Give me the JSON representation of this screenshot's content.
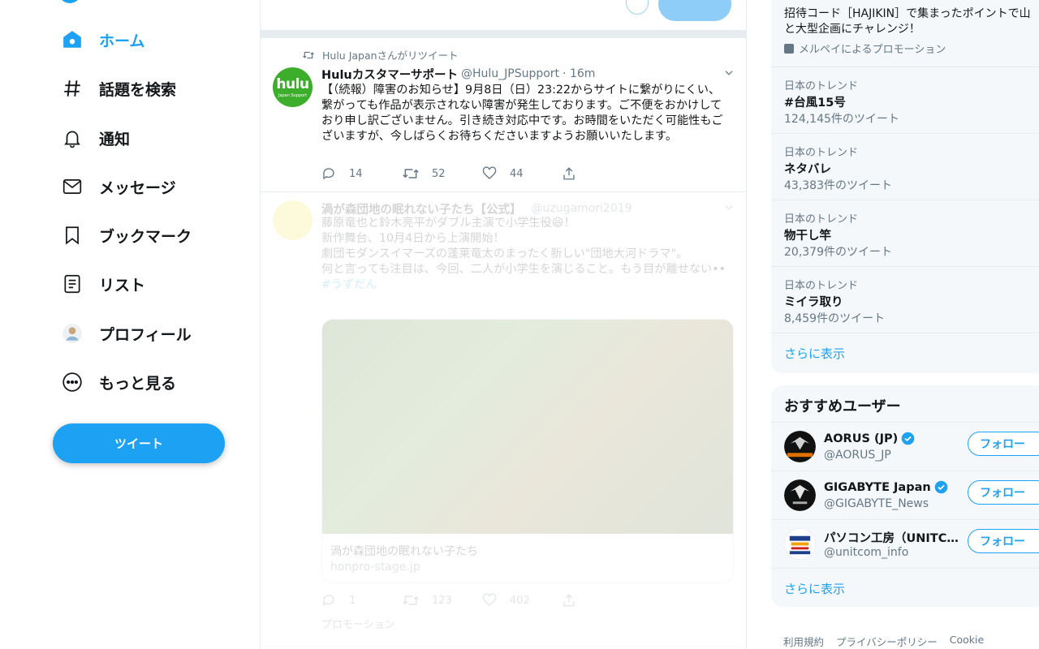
{
  "nav": {
    "items": [
      {
        "label": "ホーム",
        "icon": "home-icon",
        "active": true
      },
      {
        "label": "話題を検索",
        "icon": "hashtag-icon"
      },
      {
        "label": "通知",
        "icon": "bell-icon"
      },
      {
        "label": "メッセージ",
        "icon": "envelope-icon"
      },
      {
        "label": "ブックマーク",
        "icon": "bookmark-icon"
      },
      {
        "label": "リスト",
        "icon": "list-icon"
      },
      {
        "label": "プロフィール",
        "icon": "avatar-icon"
      },
      {
        "label": "もっと見る",
        "icon": "more-circle-icon"
      }
    ],
    "tweet_button": "ツイート"
  },
  "timeline": {
    "tweet1": {
      "retweet_by": "Hulu Japanさんがリツイート",
      "avatar_text": "hulu",
      "avatar_sub": "Japan Support",
      "name": "Huluカスタマーサポート",
      "handle": "@Hulu_JPSupport",
      "time": "· 16m",
      "body": "【（続報）障害のお知らせ】9月8日（日）23:22からサイトに繋がりにくい、繋がっても作品が表示されない障害が発生しております。ご不便をおかけしており申し訳ございません。引き続き対応中です。お時間をいただく可能性もございますが、今しばらくお待ちくださいますようお願いいたします。",
      "replies": "14",
      "retweets": "52",
      "likes": "44"
    },
    "tweet2": {
      "name": "渦が森団地の眠れない子たち【公式】",
      "handle": "@uzugamori2019",
      "body_lines": [
        "藤原竜也と鈴木亮平がダブル主演で小学生役😆！",
        "新作舞台、10月4日から上演開始！",
        "劇団モダンスイマーズの蓬莱竜太のまったく新しい\"団地大河ドラマ\"。",
        "何と言っても注目は、今回、二人が小学生を演じること。もう目が離せない••"
      ],
      "hashtag": "#うずだん",
      "card_title": "渦が森団地の眠れない子たち",
      "card_link": "honpro-stage.jp",
      "replies": "1",
      "retweets": "123",
      "likes": "402",
      "promotion": "プロモーション"
    }
  },
  "sidebar": {
    "promo_line1": "招待コード［HAJIKIN］で集まったポイントで山",
    "promo_line2": "と大型企画にチャレンジ！",
    "promo_by": "メルペイによるプロモーション",
    "trends": [
      {
        "category": "日本のトレンド",
        "title": "#台風15号",
        "count": "124,145件のツイート"
      },
      {
        "category": "日本のトレンド",
        "title": "ネタバレ",
        "count": "43,383件のツイート"
      },
      {
        "category": "日本のトレンド",
        "title": "物干し竿",
        "count": "20,379件のツイート"
      },
      {
        "category": "日本のトレンド",
        "title": "ミイラ取り",
        "count": "8,459件のツイート"
      }
    ],
    "show_more": "さらに表示",
    "who_to_follow_title": "おすすめユーザー",
    "users": [
      {
        "name": "AORUS (JP)",
        "handle": "@AORUS_JP",
        "verified": true,
        "follow": "フォロー"
      },
      {
        "name": "GIGABYTE Japan",
        "handle": "@GIGABYTE_News",
        "verified": true,
        "follow": "フォロー"
      },
      {
        "name": "パソコン工房（UNITC…",
        "handle": "@unitcom_info",
        "verified": false,
        "follow": "フォロー"
      }
    ],
    "users_show_more": "さらに表示",
    "footer": [
      "利用規約",
      "プライバシーポリシー",
      "Cookie"
    ]
  },
  "colors": {
    "accent": "#1da1f2",
    "text": "#14171a",
    "muted": "#657786",
    "panel": "#f5f8fa"
  }
}
